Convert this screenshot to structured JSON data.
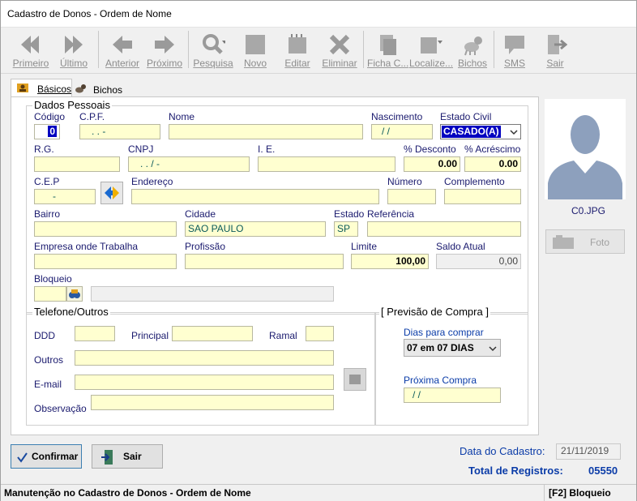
{
  "window": {
    "title": "Cadastro de Donos - Ordem de Nome"
  },
  "toolbar": {
    "items": [
      {
        "label": "Primeiro",
        "icon": "first-record-icon"
      },
      {
        "label": "Último",
        "icon": "last-record-icon"
      },
      {
        "label": "Anterior",
        "icon": "previous-record-icon"
      },
      {
        "label": "Próximo",
        "icon": "next-record-icon"
      },
      {
        "label": "Pesquisa",
        "icon": "search-icon"
      },
      {
        "label": "Novo",
        "icon": "new-record-icon"
      },
      {
        "label": "Editar",
        "icon": "edit-icon"
      },
      {
        "label": "Eliminar",
        "icon": "delete-icon"
      },
      {
        "label": "Ficha C...",
        "icon": "record-card-icon"
      },
      {
        "label": "Localize...",
        "icon": "locate-icon"
      },
      {
        "label": "Bichos",
        "icon": "pets-icon"
      },
      {
        "label": "SMS",
        "icon": "sms-icon"
      },
      {
        "label": "Sair",
        "icon": "exit-icon"
      }
    ]
  },
  "tabs": [
    {
      "label": "Básicos"
    },
    {
      "label": "Bichos"
    }
  ],
  "dados_pessoais": {
    "title": "Dados Pessoais",
    "codigo": {
      "label": "Código",
      "value": "0"
    },
    "cpf": {
      "label": "C.P.F.",
      "value": ".   .   -"
    },
    "nome": {
      "label": "Nome",
      "value": ""
    },
    "nascimento": {
      "label": "Nascimento",
      "value": "/  /"
    },
    "estado_civil": {
      "label": "Estado Civil",
      "value": "CASADO(A)"
    },
    "rg": {
      "label": "R.G.",
      "value": ""
    },
    "cnpj": {
      "label": "CNPJ",
      "value": ".   .   /    -"
    },
    "ie": {
      "label": "I. E.",
      "value": ""
    },
    "desconto": {
      "label": "% Desconto",
      "value": "0.00"
    },
    "acrescimo": {
      "label": "% Acréscimo",
      "value": "0.00"
    },
    "cep": {
      "label": "C.E.P",
      "value": "-"
    },
    "endereco": {
      "label": "Endereço",
      "value": ""
    },
    "numero": {
      "label": "Número",
      "value": ""
    },
    "complemento": {
      "label": "Complemento",
      "value": ""
    },
    "bairro": {
      "label": "Bairro",
      "value": ""
    },
    "cidade": {
      "label": "Cidade",
      "value": "SAO PAULO"
    },
    "estado": {
      "label": "Estado",
      "value": "SP"
    },
    "referencia": {
      "label": "Referência",
      "value": ""
    },
    "empresa": {
      "label": "Empresa onde Trabalha",
      "value": ""
    },
    "profissao": {
      "label": "Profissão",
      "value": ""
    },
    "limite": {
      "label": "Limite",
      "value": "100,00"
    },
    "saldo": {
      "label": "Saldo Atual",
      "value": "0,00"
    },
    "bloqueio": {
      "label": "Bloqueio",
      "value": ""
    }
  },
  "telefone": {
    "title": "Telefone/Outros",
    "ddd": {
      "label": "DDD",
      "value": ""
    },
    "principal": {
      "label": "Principal",
      "value": ""
    },
    "ramal": {
      "label": "Ramal",
      "value": ""
    },
    "outros": {
      "label": "Outros",
      "value": ""
    },
    "email": {
      "label": "E-mail",
      "value": ""
    },
    "observacao": {
      "label": "Observação",
      "value": ""
    }
  },
  "previsao": {
    "title": "[ Previsão de Compra ]",
    "dias_label": "Dias para comprar",
    "dias_value": "07 em 07 DIAS",
    "proxima_label": "Próxima Compra",
    "proxima_value": "/  /"
  },
  "photo": {
    "filename": "C0.JPG",
    "button": "Foto"
  },
  "buttons": {
    "confirmar": "Confirmar",
    "sair": "Sair"
  },
  "footer": {
    "data_cadastro_label": "Data do Cadastro:",
    "data_cadastro_value": "21/11/2019",
    "total_label": "Total de Registros:",
    "total_value": "05550"
  },
  "status": {
    "left": "Manutenção no Cadastro de Donos - Ordem de Nome",
    "right": "[F2] Bloqueio"
  },
  "colors": {
    "accent_blue": "#0b3ca8",
    "field_yellow": "#ffffd0",
    "selection_blue": "#0000c0"
  }
}
